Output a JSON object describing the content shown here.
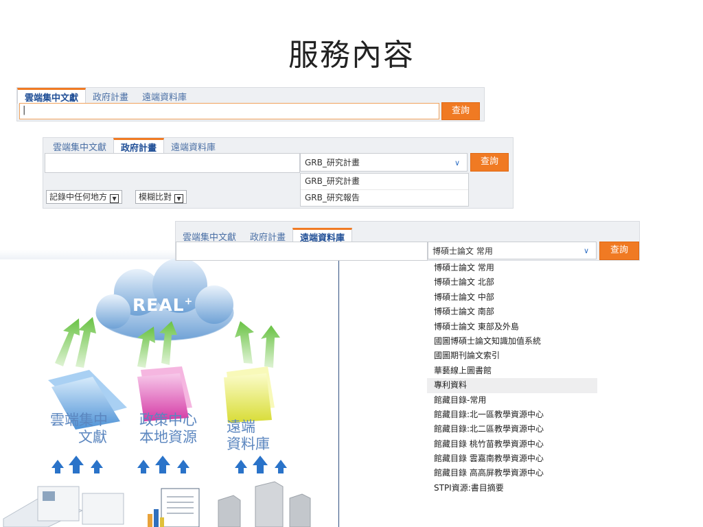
{
  "page_title": "服務內容",
  "widget1": {
    "tabs": [
      "雲端集中文獻",
      "政府計畫",
      "遠端資料庫"
    ],
    "active_tab": 0,
    "input_value": "|",
    "search_button": "查詢"
  },
  "widget2": {
    "tabs": [
      "雲端集中文獻",
      "政府計畫",
      "遠端資料庫"
    ],
    "active_tab": 1,
    "select_value": "GRB_研究計畫",
    "search_button": "查詢",
    "dropdown_options": [
      "GRB_研究計畫",
      "GRB_研究報告"
    ],
    "filter1": "記錄中任何地方",
    "filter2": "模糊比對"
  },
  "widget3": {
    "tabs": [
      "雲端集中文獻",
      "政府計畫",
      "遠端資料庫"
    ],
    "active_tab": 2,
    "select_value": "博碩士論文 常用",
    "search_button": "查詢",
    "options": [
      "博碩士論文 常用",
      "博碩士論文 北部",
      "博碩士論文 中部",
      "博碩士論文 南部",
      "博碩士論文 東部及外島",
      "國圖博碩士論文知識加值系統",
      "國圖期刊論文索引",
      "華藝線上圖書館",
      "專利資料",
      "館藏目錄-常用",
      "館藏目錄:北一區教學資源中心",
      "館藏目錄:北二區教學資源中心",
      "館藏目錄 桃竹苗教學資源中心",
      "館藏目錄 雲嘉南教學資源中心",
      "館藏目錄 高高屏教學資源中心",
      "STPI資源:書目摘要"
    ],
    "highlighted_index": 8
  },
  "diagram": {
    "cloud_label": "REAL",
    "cloud_sup": "+",
    "folders": [
      {
        "line1": "雲端集中",
        "line2": "文獻"
      },
      {
        "line1": "政策中心",
        "line2": "本地資源"
      },
      {
        "line1": "遠端",
        "line2": "資料庫"
      }
    ],
    "colors": {
      "cloud": "#6fa2d6",
      "folder1": "#7fb3e8",
      "folder2": "#e04fb5",
      "folder3": "#e7ea5a",
      "arrow_up": "#7ccc5a",
      "arrow_blue": "#2a73c9"
    }
  }
}
